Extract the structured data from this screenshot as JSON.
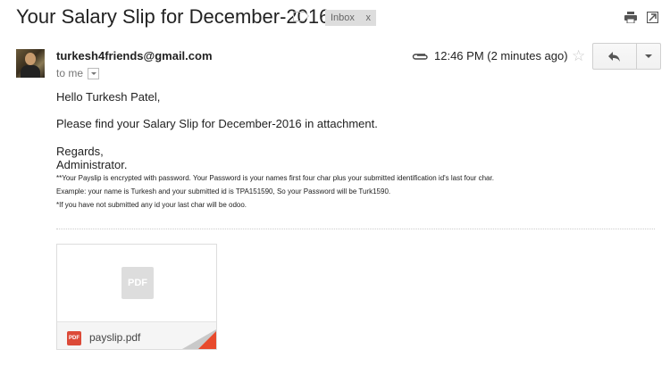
{
  "email": {
    "subject": "Your Salary Slip for December-2016",
    "label_chip": {
      "text": "Inbox",
      "remove": "x"
    },
    "sender": "turkesh4friends@gmail.com",
    "recipient": "to me",
    "timestamp": "12:46 PM (2 minutes ago)",
    "body": {
      "greeting": "Hello Turkesh Patel,",
      "line1": "Please find your Salary Slip for December-2016 in attachment.",
      "regards": "Regards,",
      "signature": "Administrator.",
      "note1": "**Your Payslip is encrypted with password. Your Password is your names first four char plus your submitted identification id's last four char.",
      "note2": "Example: your name is Turkesh and your submitted id is TPA151590, So your Password will be Turk1590.",
      "note3": "*If you have not submitted any id your last char will be odoo."
    },
    "attachment": {
      "filename": "payslip.pdf",
      "type_label": "PDF"
    }
  },
  "icons": {
    "label": "label-tag-icon",
    "print": "print-icon",
    "new_window": "new-window-icon",
    "attachment": "paperclip-icon",
    "star": "star-icon",
    "reply": "reply-arrow-icon",
    "more": "chevron-down-icon"
  },
  "colors": {
    "pdf_red": "#dc4a38",
    "chip_bg": "#dddddd"
  }
}
